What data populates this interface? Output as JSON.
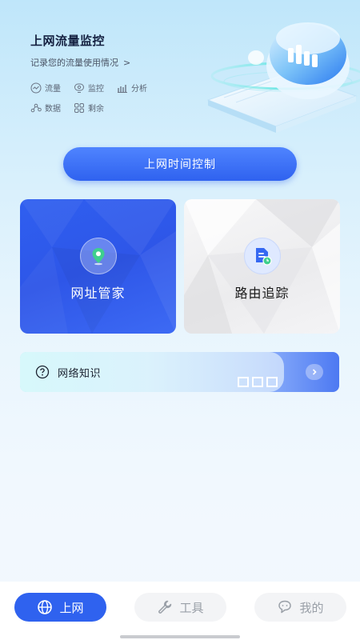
{
  "header": {
    "title": "上网流量监控",
    "subtitle": "记录您的流量使用情况",
    "subtitle_chevron": ">"
  },
  "tags": [
    {
      "icon": "trend-icon",
      "label": "流量"
    },
    {
      "icon": "monitor-icon",
      "label": "监控"
    },
    {
      "icon": "bar-chart-icon",
      "label": "分析"
    },
    {
      "icon": "nodes-icon",
      "label": "数据"
    },
    {
      "icon": "grid-icon",
      "label": "剩余"
    }
  ],
  "primary_button": {
    "label": "上网时间控制"
  },
  "cards": [
    {
      "icon": "location-pin-icon",
      "label": "网址管家"
    },
    {
      "icon": "document-clock-icon",
      "label": "路由追踪"
    }
  ],
  "knowledge": {
    "icon": "question-circle-icon",
    "label": "网络知识",
    "arrow": "chevron-right-icon"
  },
  "tabbar": [
    {
      "icon": "globe-icon",
      "label": "上网",
      "active": true
    },
    {
      "icon": "wrench-icon",
      "label": "工具",
      "active": false
    },
    {
      "icon": "chat-icon",
      "label": "我的",
      "active": false
    }
  ],
  "colors": {
    "accent": "#2f62ef",
    "accent_light": "#4f84ff",
    "text_dark": "#142040",
    "text_muted": "#5a6474",
    "tab_inactive": "#9aa0a8"
  }
}
